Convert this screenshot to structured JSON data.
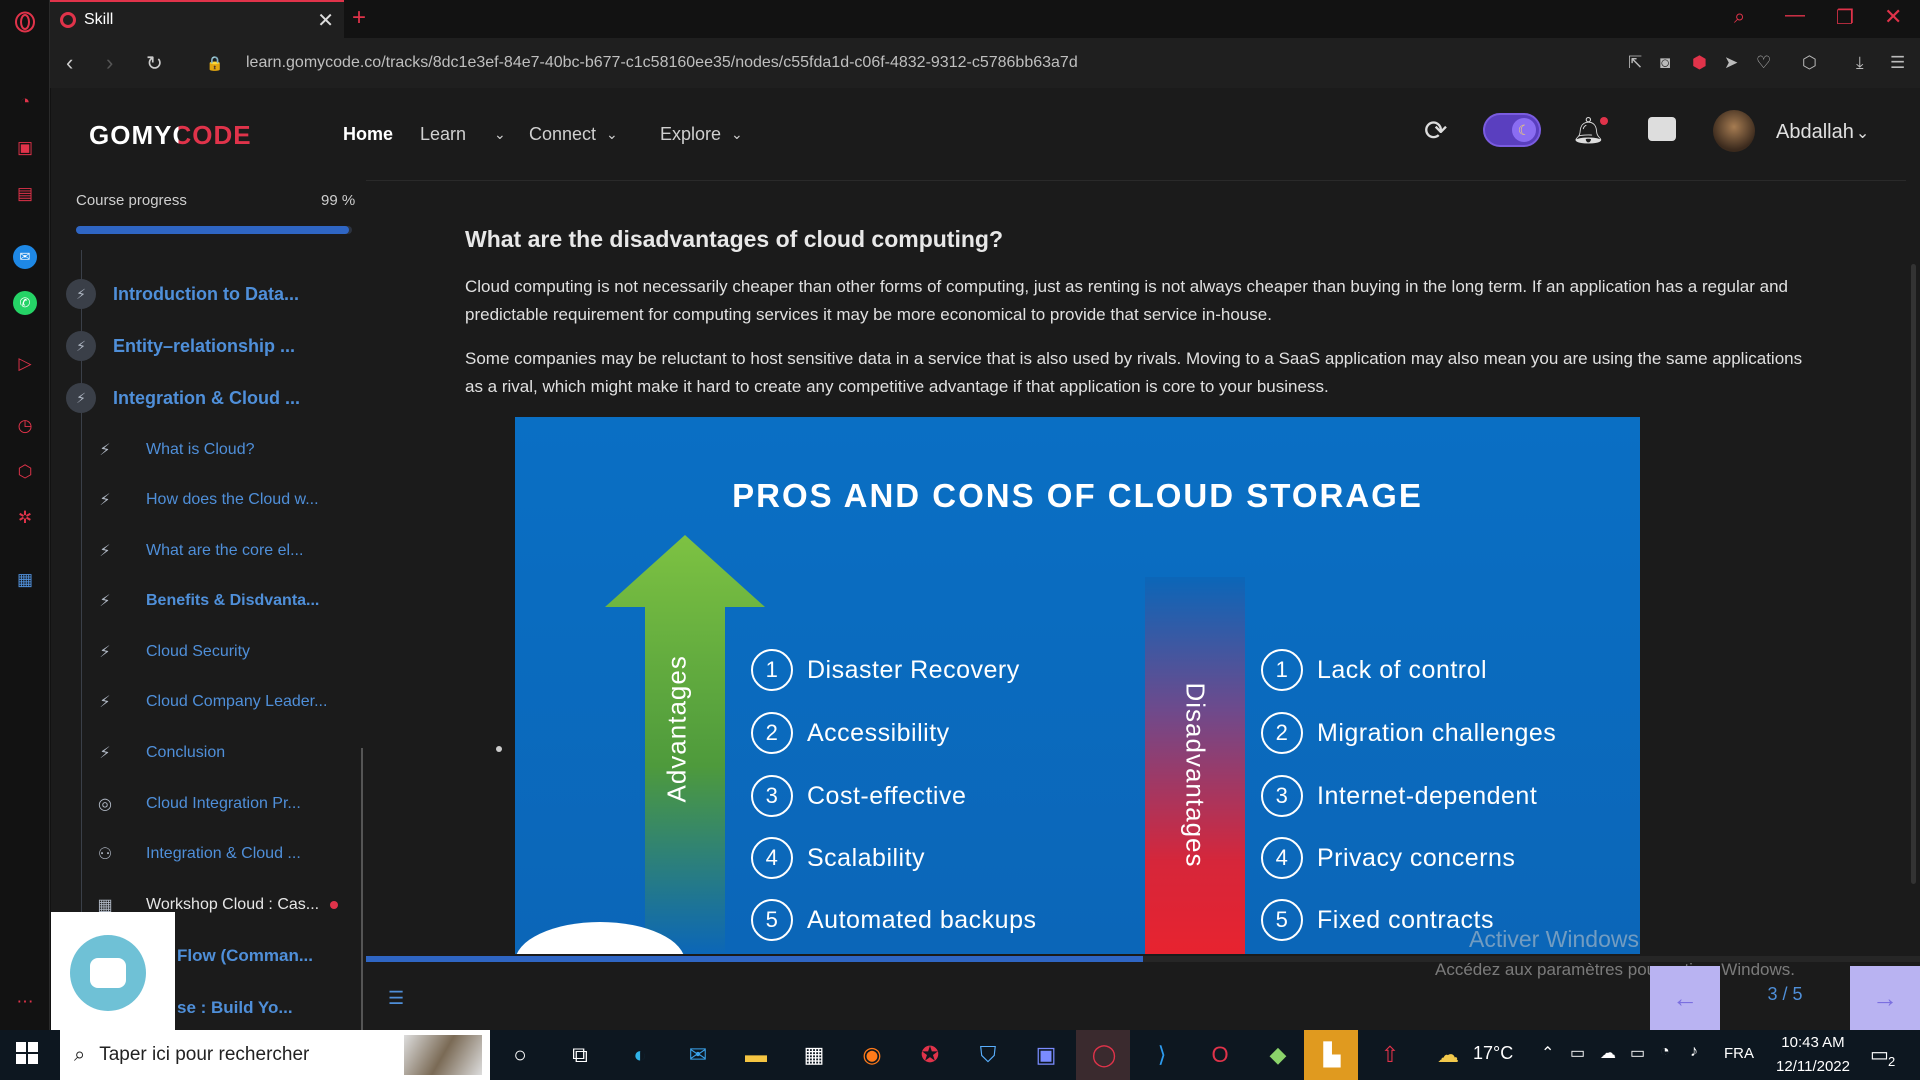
{
  "browser": {
    "tab_title": "Skill",
    "url": "learn.gomycode.co/tracks/8dc1e3ef-84e7-40bc-b677-c1c58160ee35/nodes/c55fda1d-c06f-4832-9312-c5786bb63a7d"
  },
  "header": {
    "logo": "GOMYCODE",
    "nav": [
      {
        "label": "Home"
      },
      {
        "label": "Learn"
      },
      {
        "label": "Connect"
      },
      {
        "label": "Explore"
      }
    ],
    "user": "Abdallah"
  },
  "sidebar": {
    "progress_label": "Course progress",
    "progress_value": "99 %",
    "progress_fraction": 0.99,
    "chapters": [
      {
        "label": "Introduction to Data..."
      },
      {
        "label": "Entity–relationship ..."
      },
      {
        "label": "Integration & Cloud ..."
      }
    ],
    "lessons": [
      {
        "label": "What is Cloud?",
        "icon": "bolt-icon"
      },
      {
        "label": "How does the Cloud w...",
        "icon": "bolt-icon"
      },
      {
        "label": "What are the core el...",
        "icon": "bolt-icon"
      },
      {
        "label": "Benefits & Disdvanta...",
        "icon": "bolt-icon"
      },
      {
        "label": "Cloud Security",
        "icon": "bolt-icon"
      },
      {
        "label": "Cloud Company Leader...",
        "icon": "bolt-icon"
      },
      {
        "label": "Conclusion",
        "icon": "bolt-icon"
      },
      {
        "label": "Cloud Integration Pr...",
        "icon": "target-icon"
      },
      {
        "label": "Integration & Cloud ...",
        "icon": "people-icon"
      },
      {
        "label": "Workshop Cloud : Cas...",
        "icon": "board-icon"
      }
    ],
    "more": [
      {
        "label": "Flow (Comman..."
      },
      {
        "label": "se : Build Yo..."
      }
    ]
  },
  "content": {
    "heading": "What are the disadvantages of cloud computing?",
    "paragraph1": "Cloud computing is not necessarily cheaper than other forms of computing, just as renting is not always cheaper than buying in the long term. If an application has a regular and predictable requirement for computing services it may be more economical to provide that service in-house.",
    "paragraph2": "Some companies may be reluctant to host sensitive data in a service that is also used by rivals. Moving to a SaaS application may also mean you are using the same applications as a rival, which might make it hard to create any competitive advantage if that application is core to your business.",
    "figure": {
      "title": "PROS AND CONS OF CLOUD STORAGE",
      "left_label": "Advantages",
      "right_label": "Disadvantages",
      "advantages": [
        "Disaster Recovery",
        "Accessibility",
        "Cost-effective",
        "Scalability",
        "Automated backups"
      ],
      "disadvantages": [
        "Lack of control",
        "Migration challenges",
        "Internet-dependent",
        "Privacy concerns",
        "Fixed contracts"
      ],
      "numbers": [
        "1",
        "2",
        "3",
        "4",
        "5"
      ]
    }
  },
  "pager": {
    "text": "3 / 5",
    "prev": "←",
    "next": "→",
    "progress_fraction": 0.5
  },
  "watermark": {
    "line1": "Activer Windows",
    "line2": "Accédez aux paramètres pour activer Windows."
  },
  "taskbar": {
    "search_placeholder": "Taper ici pour rechercher",
    "weather": "17°C",
    "lang": "FRA",
    "time": "10:43 AM",
    "date": "12/11/2022",
    "notif_count": "2"
  }
}
